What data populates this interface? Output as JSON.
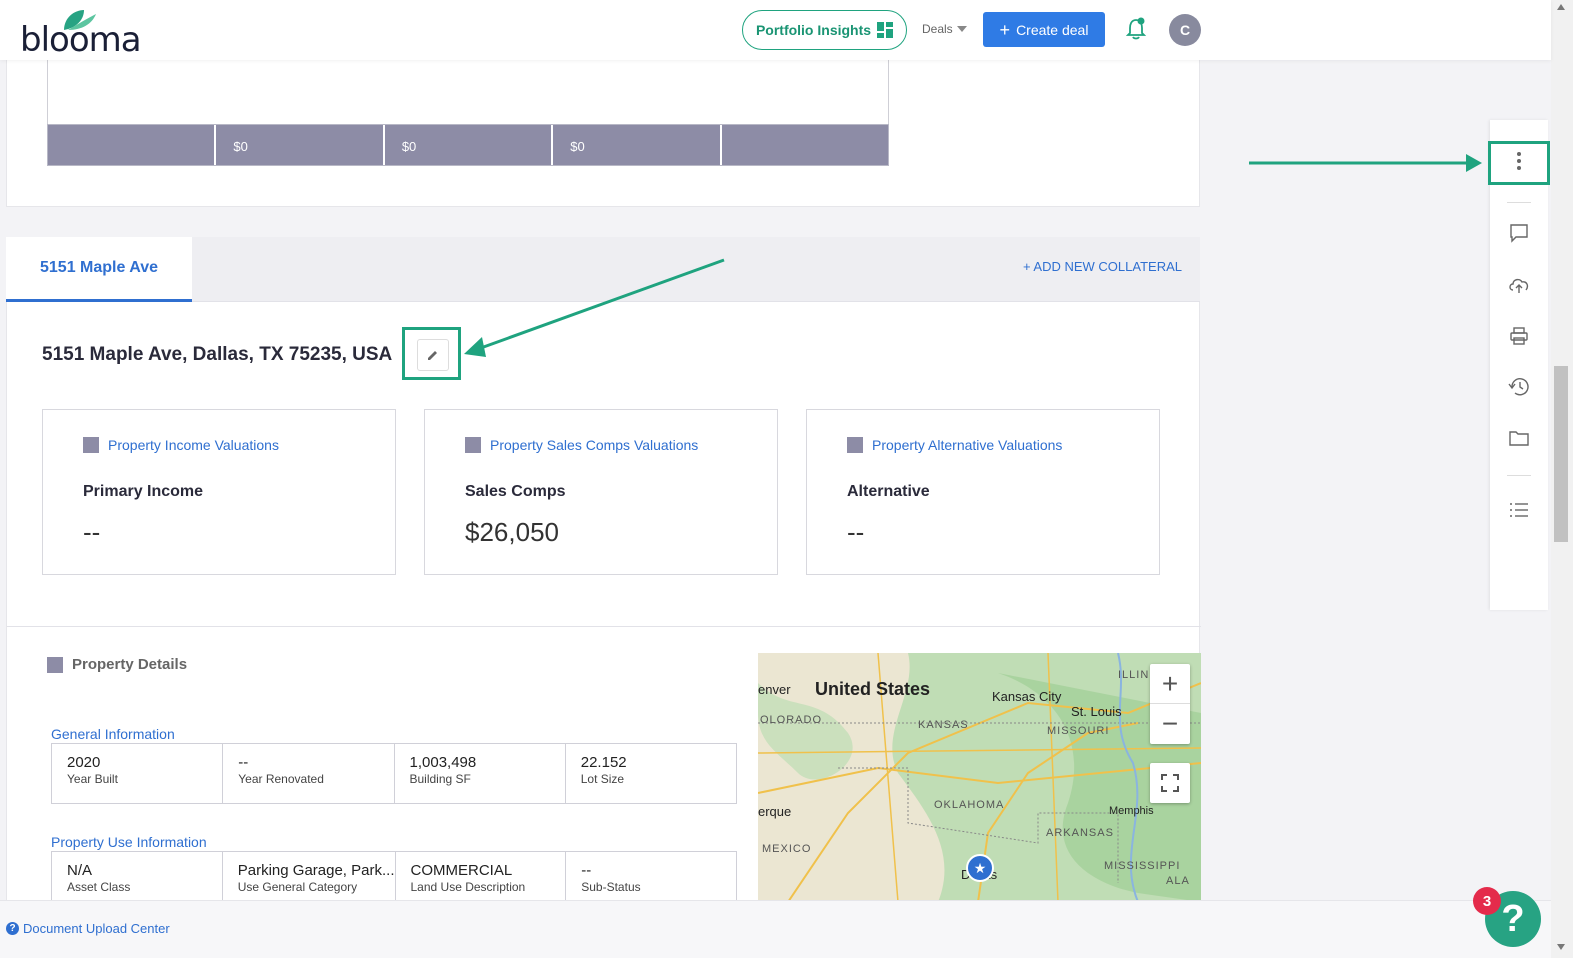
{
  "header": {
    "logo_text": "blooma",
    "portfolio_insights_label": "Portfolio Insights",
    "deals_label": "Deals",
    "create_deal_label": "Create deal",
    "avatar_initial": "C"
  },
  "summary_row": [
    "",
    "$0",
    "$0",
    "$0",
    ""
  ],
  "collateral_tab": {
    "active_tab_label": "5151 Maple Ave",
    "add_collateral_label": "+ ADD NEW COLLATERAL"
  },
  "property": {
    "address": "5151 Maple Ave, Dallas, TX 75235, USA",
    "valuations": [
      {
        "heading": "Property Income Valuations",
        "label": "Primary Income",
        "value": "--"
      },
      {
        "heading": "Property Sales Comps Valuations",
        "label": "Sales Comps",
        "value": "$26,050"
      },
      {
        "heading": "Property Alternative Valuations",
        "label": "Alternative",
        "value": "--"
      }
    ],
    "details_heading": "Property Details",
    "general_info_title": "General Information",
    "general_info": [
      {
        "value": "2020",
        "label": "Year Built"
      },
      {
        "value": "--",
        "label": "Year Renovated"
      },
      {
        "value": "1,003,498",
        "label": "Building SF"
      },
      {
        "value": "22.152",
        "label": "Lot Size"
      }
    ],
    "use_info_title": "Property Use Information",
    "use_info": [
      {
        "value": "N/A",
        "label": "Asset Class"
      },
      {
        "value": "Parking Garage, Park...",
        "label": "Use General Category"
      },
      {
        "value": "COMMERCIAL",
        "label": "Land Use Description"
      },
      {
        "value": "--",
        "label": "Sub-Status"
      }
    ]
  },
  "map": {
    "country": "United States",
    "cities": [
      "Kansas City",
      "St. Louis",
      "Memphis",
      "Dallas",
      "enver",
      "erque"
    ],
    "states": [
      "OLORADO",
      "KANSAS",
      "MISSOURI",
      "OKLAHOMA",
      "ARKANSAS",
      "MISSISSIPPI",
      "MEXICO",
      "ILLIN",
      "ALA"
    ]
  },
  "footer": {
    "doc_upload_label": "Document Upload Center",
    "help_badge_count": "3"
  },
  "colors": {
    "accent_blue": "#2f6fd0",
    "brand_green": "#1fa37f",
    "header_gray": "#8d8ca6"
  }
}
